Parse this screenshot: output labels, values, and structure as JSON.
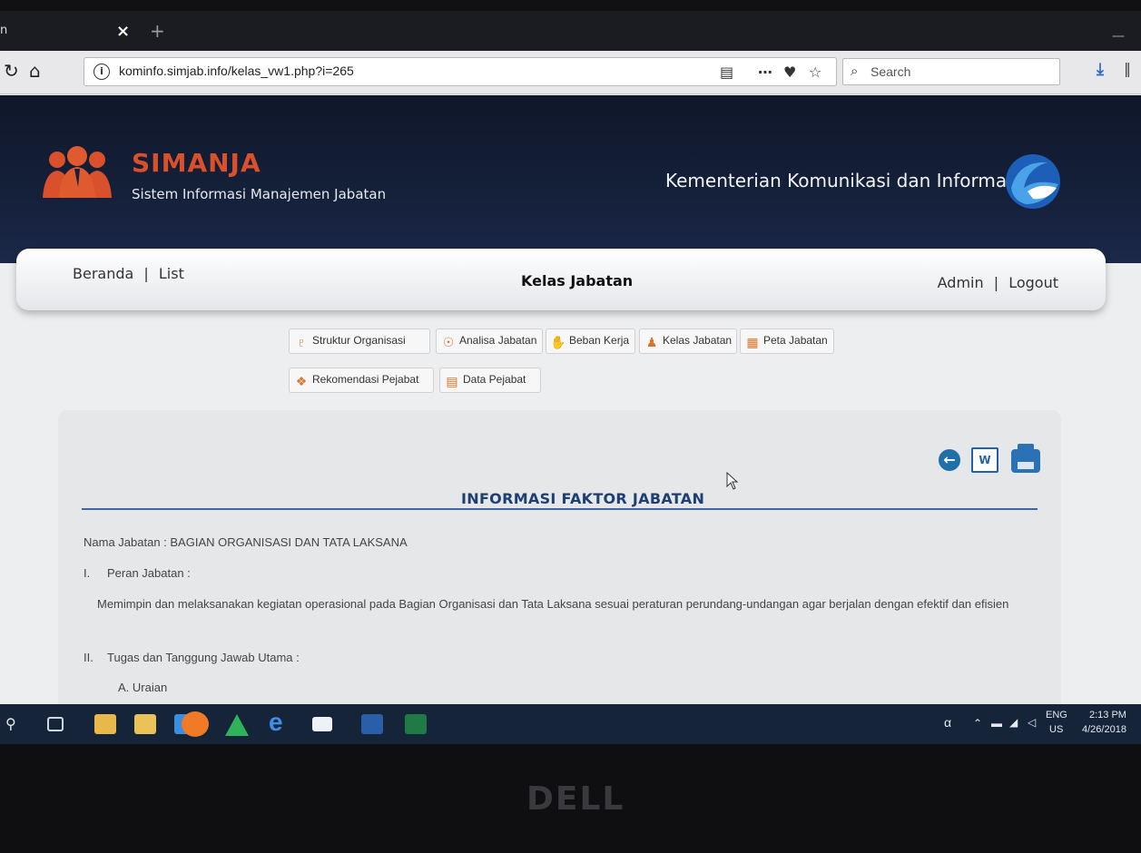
{
  "browser": {
    "tab_fragment": "n",
    "tab_close": "×",
    "new_tab": "+",
    "url": "kominfo.simjab.info/kelas_vw1.php?i=265",
    "search_placeholder": "Search"
  },
  "site": {
    "title": "SIMANJA",
    "subtitle": "Sistem Informasi Manajemen Jabatan",
    "ministry": "Kementerian Komunikasi dan Informasi"
  },
  "menubar": {
    "home": "Beranda",
    "sep": "|",
    "list": "List",
    "page_title": "Kelas Jabatan",
    "admin": "Admin",
    "logout": "Logout"
  },
  "modules": [
    {
      "label": "Struktur Organisasi",
      "icon": "org-chart-icon"
    },
    {
      "label": "Analisa Jabatan",
      "icon": "analysis-icon"
    },
    {
      "label": "Beban Kerja",
      "icon": "workload-icon"
    },
    {
      "label": "Kelas Jabatan",
      "icon": "class-icon"
    },
    {
      "label": "Peta Jabatan",
      "icon": "map-icon"
    },
    {
      "label": "Rekomendasi Pejabat",
      "icon": "recommend-icon"
    },
    {
      "label": "Data Pejabat",
      "icon": "data-icon"
    }
  ],
  "content": {
    "heading": "INFORMASI FAKTOR JABATAN",
    "nama_jabatan": "Nama Jabatan : BAGIAN ORGANISASI DAN TATA LAKSANA",
    "sec1_num": "I.",
    "sec1_title": "Peran Jabatan :",
    "sec1_text": "Memimpin dan melaksanakan kegiatan operasional pada Bagian Organisasi dan Tata Laksana sesuai peraturan perundang-undangan agar berjalan dengan efektif dan efisien",
    "sec2_num": "II.",
    "sec2_title": "Tugas dan Tanggung Jawab Utama :",
    "sec2_sub": "A. Uraian",
    "word_label": "W"
  },
  "taskbar": {
    "lang_top": "ENG",
    "lang_bottom": "US",
    "time": "2:13 PM",
    "date": "4/26/2018"
  },
  "brand": "DELL"
}
